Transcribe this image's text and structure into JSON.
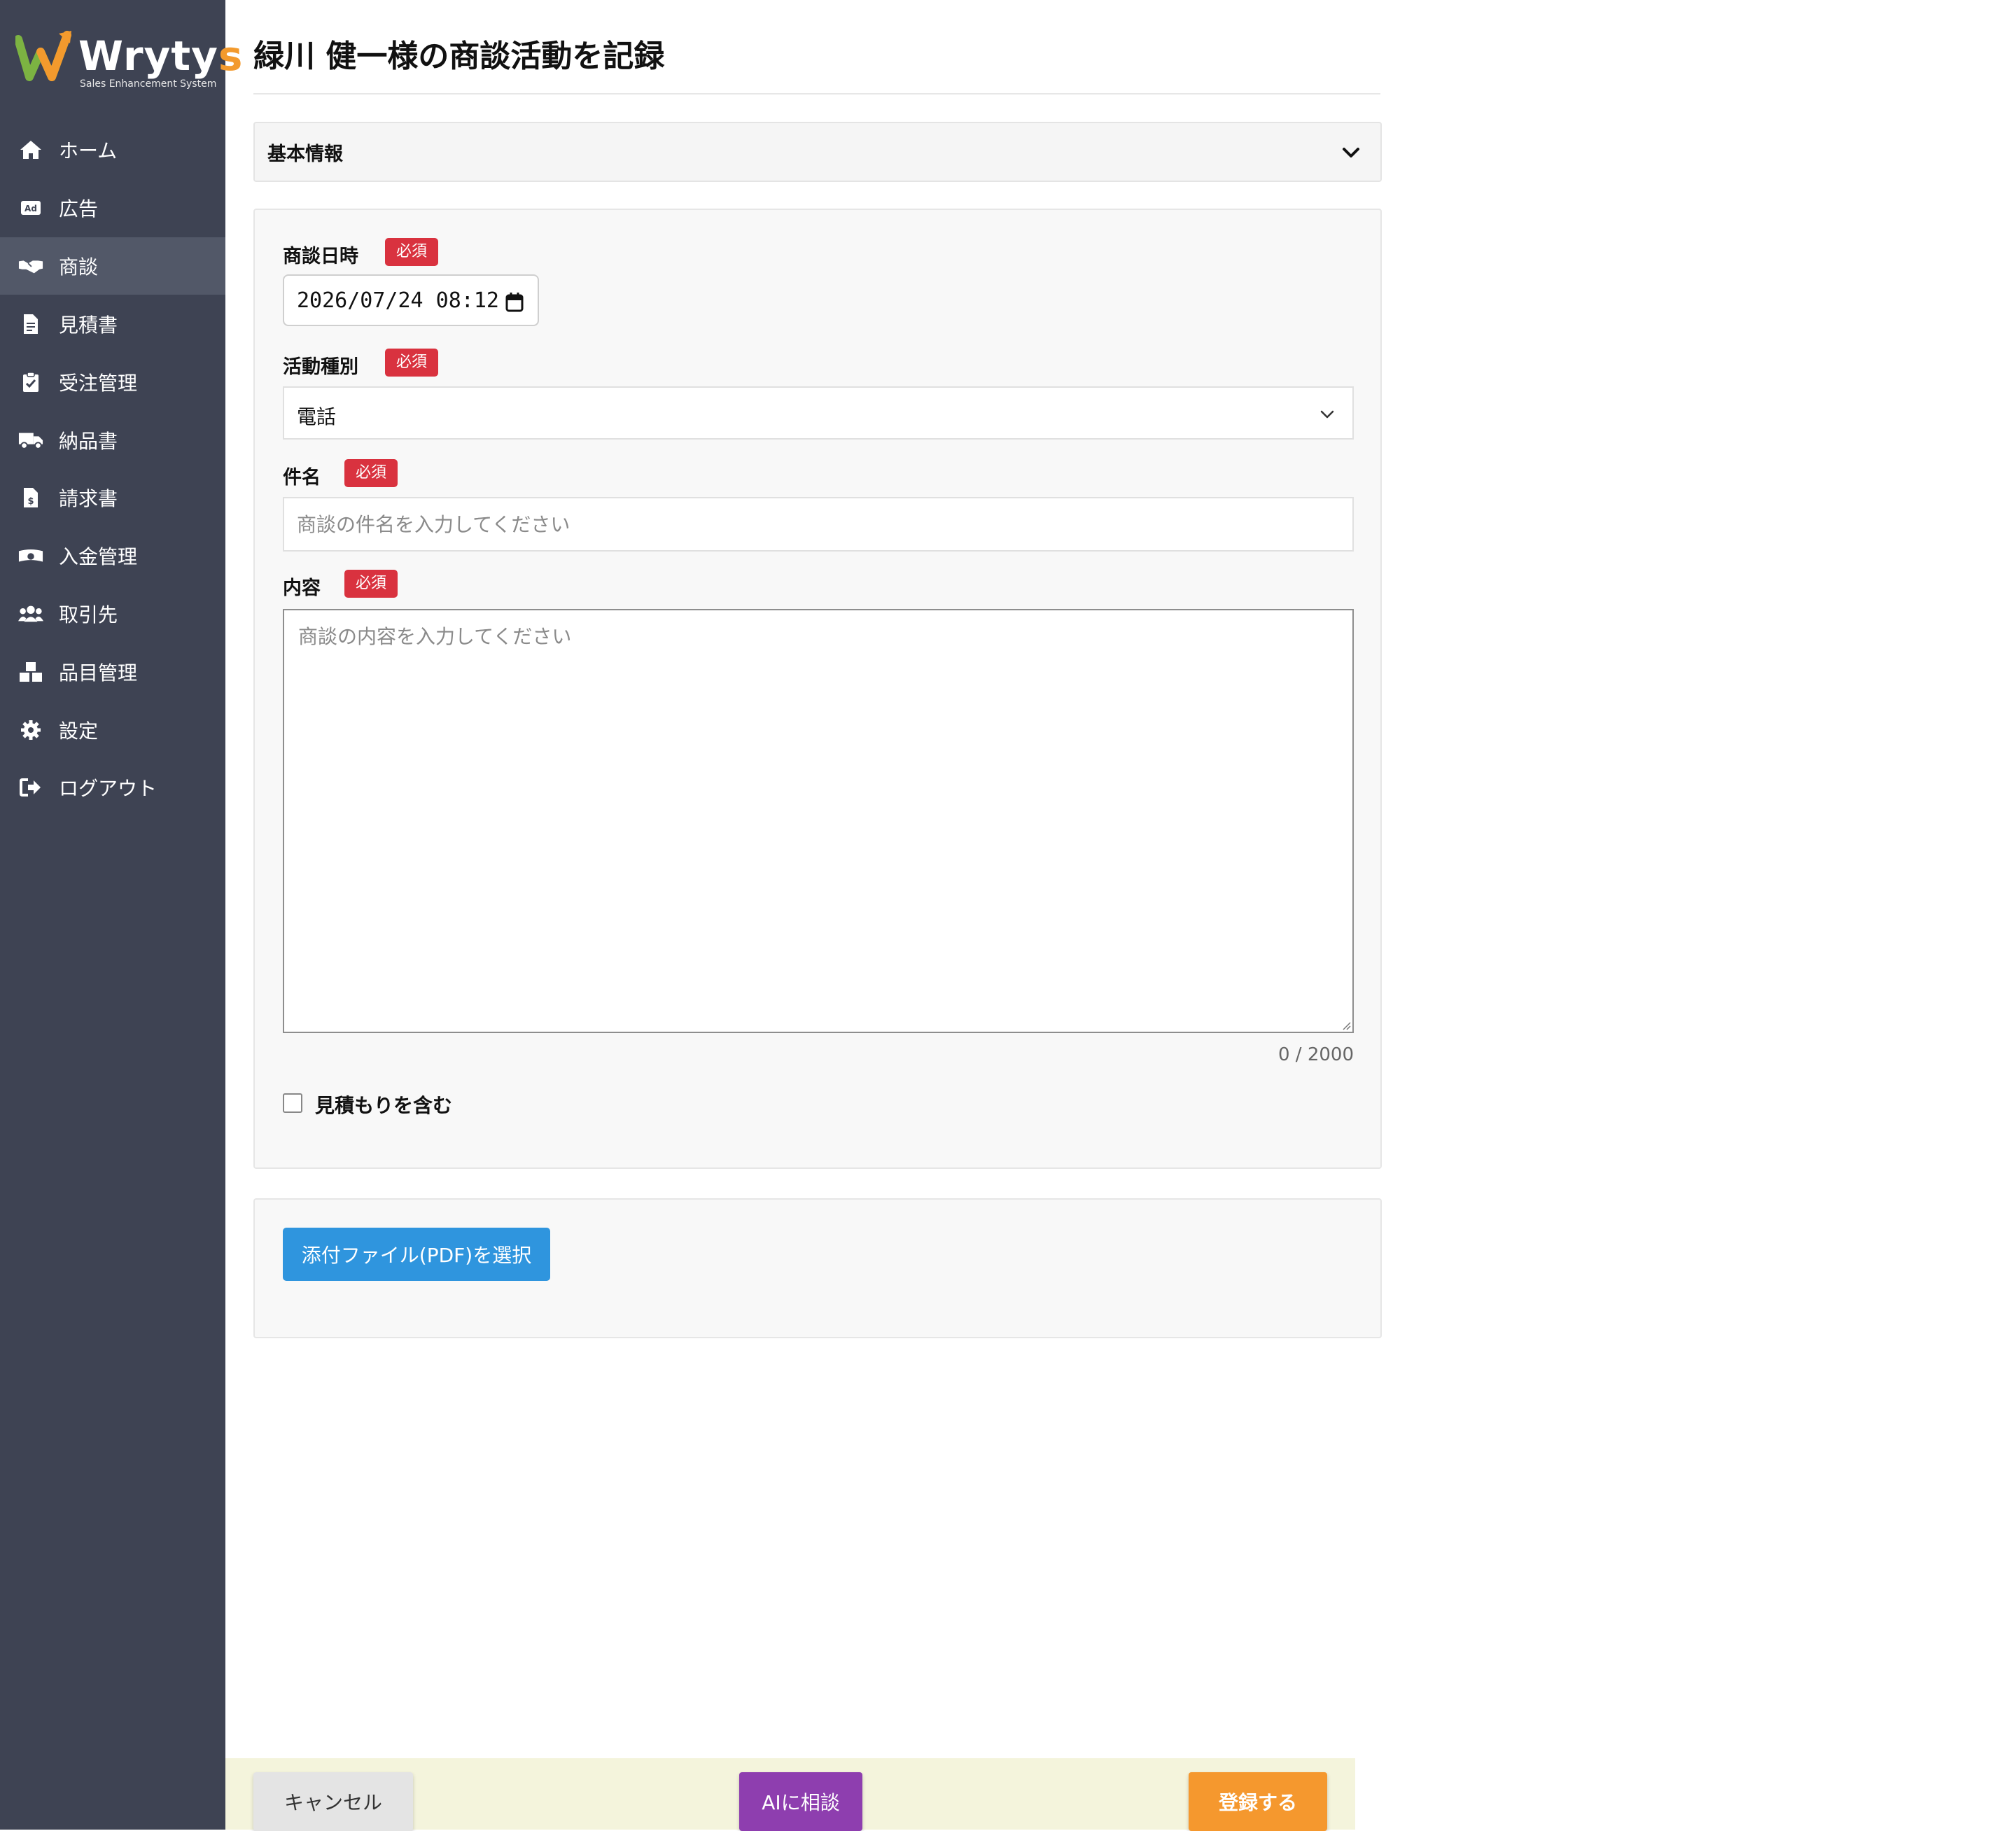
{
  "app": {
    "logo_text_main": "Wryty",
    "logo_text_accent": "s",
    "logo_subtitle": "Sales Enhancement System"
  },
  "sidebar": {
    "items": [
      {
        "label": "ホーム",
        "icon": "home-icon"
      },
      {
        "label": "広告",
        "icon": "ad-icon"
      },
      {
        "label": "商談",
        "icon": "handshake-icon",
        "active": true
      },
      {
        "label": "見積書",
        "icon": "document-icon"
      },
      {
        "label": "受注管理",
        "icon": "clipboard-check-icon"
      },
      {
        "label": "納品書",
        "icon": "truck-icon"
      },
      {
        "label": "請求書",
        "icon": "invoice-icon"
      },
      {
        "label": "入金管理",
        "icon": "money-icon"
      },
      {
        "label": "取引先",
        "icon": "users-icon"
      },
      {
        "label": "品目管理",
        "icon": "boxes-icon"
      },
      {
        "label": "設定",
        "icon": "gear-icon"
      },
      {
        "label": "ログアウト",
        "icon": "logout-icon"
      }
    ]
  },
  "page": {
    "title": "緑川 健一様の商談活動を記録"
  },
  "accordion": {
    "label": "基本情報"
  },
  "form": {
    "required_badge": "必須",
    "datetime_label": "商談日時",
    "datetime_value": "2026/07/24 08:12",
    "activity_label": "活動種別",
    "activity_value": "電話",
    "subject_label": "件名",
    "subject_placeholder": "商談の件名を入力してください",
    "content_label": "内容",
    "content_placeholder": "商談の内容を入力してください",
    "char_counter": "0 / 2000",
    "include_estimate_label": "見積もりを含む"
  },
  "attachment": {
    "button_label": "添付ファイル(PDF)を選択"
  },
  "footer": {
    "cancel_label": "キャンセル",
    "ai_label": "AIに相談",
    "submit_label": "登録する"
  },
  "colors": {
    "sidebar_bg": "#3e4353",
    "required": "#d9323f",
    "attach_button": "#2f95de",
    "ai_button": "#8e3eaf",
    "submit_button": "#f5982e"
  }
}
